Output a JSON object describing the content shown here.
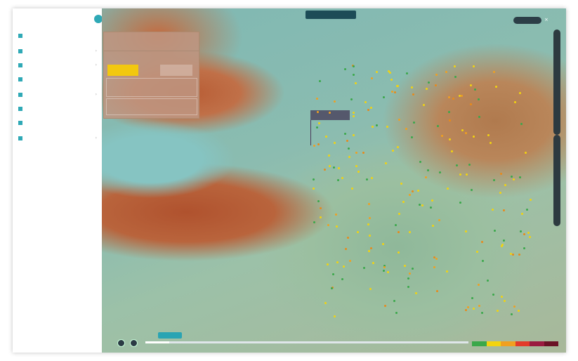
{
  "sidebar": {
    "title": "",
    "items": [
      {
        "label": "",
        "color": "#2fa9b6"
      },
      {
        "label": "",
        "color": "#2fa9b6"
      },
      {
        "label": "",
        "color": "#2fa9b6"
      },
      {
        "label": "",
        "color": "#2fa9b6"
      },
      {
        "label": "",
        "color": "#2fa9b6"
      },
      {
        "label": "",
        "color": "#2fa9b6"
      },
      {
        "label": "",
        "color": "#2fa9b6"
      },
      {
        "label": "",
        "color": "#2fa9b6"
      }
    ]
  },
  "map": {
    "top_badge": "",
    "toggle": "",
    "tooltip": "",
    "info_panel": {
      "header": "",
      "aqi": ""
    },
    "timeline": {
      "current": "",
      "dates": [
        "",
        "",
        "",
        ""
      ]
    },
    "layers": [
      "",
      "",
      "",
      "",
      "",
      "",
      "",
      "",
      "",
      "",
      "",
      "",
      ""
    ]
  },
  "legend_colors": [
    "#3aa84a",
    "#f2d40f",
    "#f0a020",
    "#e23b2a",
    "#9a1b40",
    "#6b1226"
  ]
}
